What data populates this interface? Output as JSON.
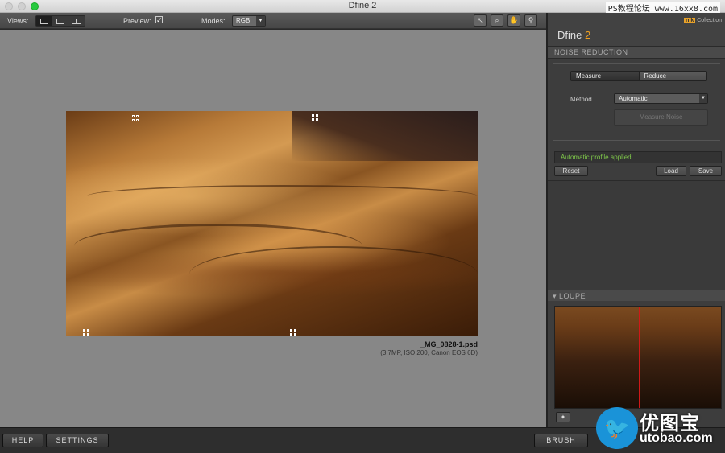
{
  "window": {
    "title": "Dfine 2",
    "watermark_top": "PS教程论坛 www.16xx8.com"
  },
  "toolbar": {
    "views_label": "Views:",
    "preview_label": "Preview:",
    "preview_checked": "✓",
    "modes_label": "Modes:",
    "mode_value": "RGB"
  },
  "canvas": {
    "file_name": "_MG_0828-1.psd",
    "file_info": "(3.7MP, ISO 200, Canon EOS 6D)"
  },
  "panel": {
    "app_name": "Dfine",
    "app_version": "2",
    "logo_brand": "nik",
    "logo_text": "Collection",
    "section_title": "NOISE REDUCTION",
    "tabs": [
      {
        "label": "Measure"
      },
      {
        "label": "Reduce"
      }
    ],
    "method_label": "Method",
    "method_value": "Automatic",
    "measure_button": "Measure Noise",
    "status_text": "Automatic profile applied",
    "reset_button": "Reset",
    "load_button": "Load",
    "save_button": "Save",
    "loupe_title": "LOUPE"
  },
  "bottom": {
    "help_button": "HELP",
    "settings_button": "SETTINGS",
    "brush_button": "BRUSH"
  },
  "watermark": {
    "cn_text": "优图宝",
    "en_text": "utobao.com"
  },
  "colors": {
    "accent": "#f0a020",
    "status_green": "#7fc94a",
    "loupe_line": "#d01818"
  }
}
